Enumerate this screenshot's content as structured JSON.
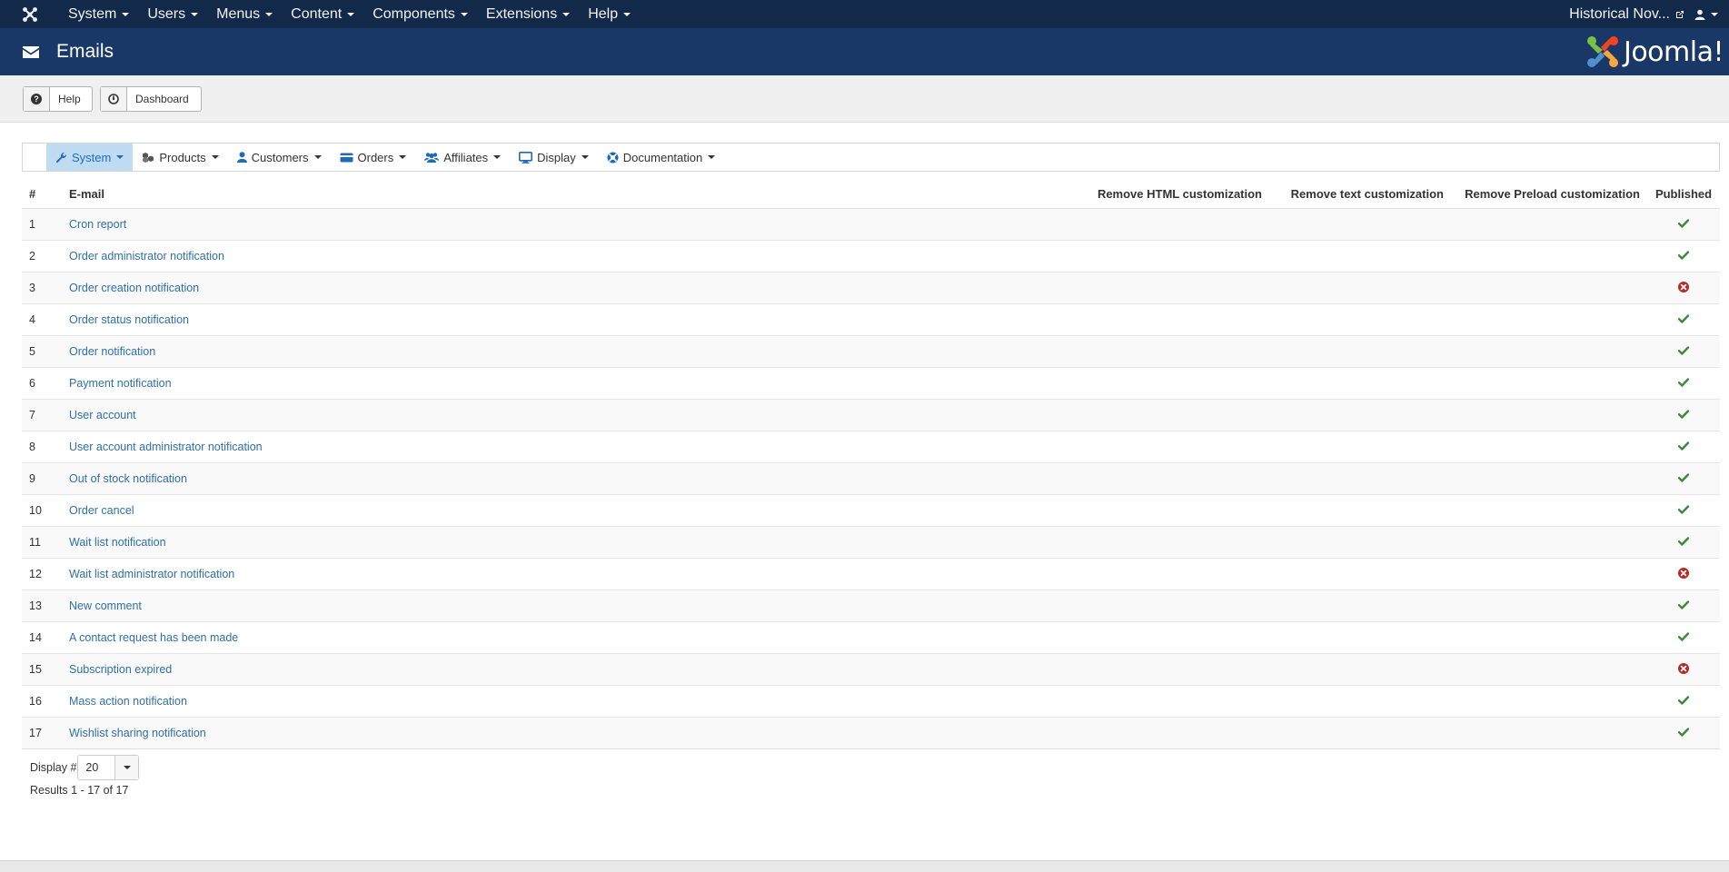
{
  "topnav": {
    "items": [
      {
        "label": "System"
      },
      {
        "label": "Users"
      },
      {
        "label": "Menus"
      },
      {
        "label": "Content"
      },
      {
        "label": "Components"
      },
      {
        "label": "Extensions"
      },
      {
        "label": "Help"
      }
    ],
    "site_name": "Historical Nov...",
    "icons": {
      "logo": "joomla-icon",
      "external": "external-link-icon",
      "user": "user-icon"
    }
  },
  "header": {
    "title": "Emails",
    "icon": "envelope-icon",
    "brand_text": "Joomla!"
  },
  "toolbar": {
    "help_label": "Help",
    "dashboard_label": "Dashboard"
  },
  "subnav": {
    "items": [
      {
        "label": "System",
        "icon": "wrench-icon",
        "active": true
      },
      {
        "label": "Products",
        "icon": "cubes-icon"
      },
      {
        "label": "Customers",
        "icon": "user-icon"
      },
      {
        "label": "Orders",
        "icon": "credit-card-icon"
      },
      {
        "label": "Affiliates",
        "icon": "users-icon"
      },
      {
        "label": "Display",
        "icon": "monitor-icon"
      },
      {
        "label": "Documentation",
        "icon": "lifebuoy-icon"
      }
    ]
  },
  "table": {
    "headers": {
      "num": "#",
      "email": "E-mail",
      "remove_html": "Remove HTML customization",
      "remove_text": "Remove text customization",
      "remove_preload": "Remove Preload customization",
      "published": "Published"
    },
    "rows": [
      {
        "num": "1",
        "name": "Cron report",
        "published": true
      },
      {
        "num": "2",
        "name": "Order administrator notification",
        "published": true
      },
      {
        "num": "3",
        "name": "Order creation notification",
        "published": false
      },
      {
        "num": "4",
        "name": "Order status notification",
        "published": true
      },
      {
        "num": "5",
        "name": "Order notification",
        "published": true
      },
      {
        "num": "6",
        "name": "Payment notification",
        "published": true
      },
      {
        "num": "7",
        "name": "User account",
        "published": true
      },
      {
        "num": "8",
        "name": "User account administrator notification",
        "published": true
      },
      {
        "num": "9",
        "name": "Out of stock notification",
        "published": true
      },
      {
        "num": "10",
        "name": "Order cancel",
        "published": true
      },
      {
        "num": "11",
        "name": "Wait list notification",
        "published": true
      },
      {
        "num": "12",
        "name": "Wait list administrator notification",
        "published": false
      },
      {
        "num": "13",
        "name": "New comment",
        "published": true
      },
      {
        "num": "14",
        "name": "A contact request has been made",
        "published": true
      },
      {
        "num": "15",
        "name": "Subscription expired",
        "published": false
      },
      {
        "num": "16",
        "name": "Mass action notification",
        "published": true
      },
      {
        "num": "17",
        "name": "Wishlist sharing notification",
        "published": true
      }
    ]
  },
  "pagination": {
    "display_label": "Display #",
    "display_value": "20",
    "results_text": "Results 1 - 17 of 17"
  },
  "colors": {
    "navbar": "#13294a",
    "header": "#1a3867",
    "link": "#2f6fab",
    "published": "#3b8a3b",
    "unpublished": "#b72a2a",
    "active_subnav": "#bfdcf2"
  }
}
